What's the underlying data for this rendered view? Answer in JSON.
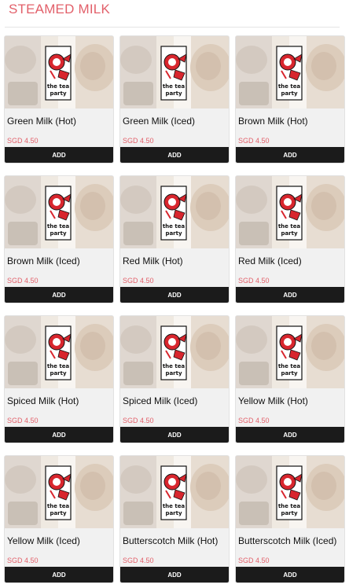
{
  "section": {
    "title": "STEAMED MILK"
  },
  "logo": {
    "text_line1": "the tea",
    "text_line2": "party"
  },
  "products": [
    {
      "name": "Green Milk (Hot)",
      "price": "SGD 4.50",
      "button": "ADD"
    },
    {
      "name": "Green Milk (Iced)",
      "price": "SGD 4.50",
      "button": "ADD"
    },
    {
      "name": "Brown Milk (Hot)",
      "price": "SGD 4.50",
      "button": "ADD"
    },
    {
      "name": "Brown Milk (Iced)",
      "price": "SGD 4.50",
      "button": "ADD"
    },
    {
      "name": "Red Milk (Hot)",
      "price": "SGD 4.50",
      "button": "ADD"
    },
    {
      "name": "Red Milk (Iced)",
      "price": "SGD 4.50",
      "button": "ADD"
    },
    {
      "name": "Spiced Milk (Hot)",
      "price": "SGD 4.50",
      "button": "ADD"
    },
    {
      "name": "Spiced Milk (Iced)",
      "price": "SGD 4.50",
      "button": "ADD"
    },
    {
      "name": "Yellow Milk (Hot)",
      "price": "SGD 4.50",
      "button": "ADD"
    },
    {
      "name": "Yellow Milk (Iced)",
      "price": "SGD 4.50",
      "button": "ADD"
    },
    {
      "name": "Butterscotch Milk (Hot)",
      "price": "SGD 4.50",
      "button": "ADD"
    },
    {
      "name": "Butterscotch Milk (Iced)",
      "price": "SGD 4.50",
      "button": "ADD"
    }
  ],
  "colors": {
    "accent": "#e2606a",
    "button_bg": "#1b1b1b",
    "card_bg": "#f1f1f1"
  }
}
